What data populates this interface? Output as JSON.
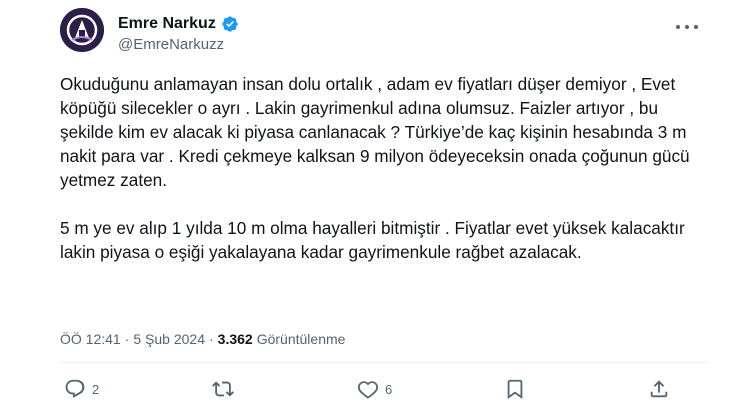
{
  "author": {
    "name": "Emre Narkuz",
    "handle": "@EmreNarkuzz"
  },
  "tweet": {
    "paragraph_1": "Okuduğunu anlamayan insan dolu ortalık , adam ev fiyatları düşer demiyor , Evet köpüğü silecekler o ayrı . Lakin gayrimenkul adına olumsuz. Faizler artıyor , bu şekilde kim ev alacak ki piyasa canlanacak ? Türkiye’de kaç kişinin hesabında 3 m nakit para var . Kredi çekmeye kalksan 9 milyon ödeyeceksin onada çoğunun gücü yetmez zaten.",
    "paragraph_2": "5 m ye ev alıp 1 yılda 10 m olma hayalleri bitmiştir . Fiyatlar evet yüksek kalacaktır lakin piyasa o eşiği yakalayana kadar gayrimenkule rağbet azalacak."
  },
  "meta": {
    "time": "ÖÖ 12:41",
    "sep1": "·",
    "date": "5 Şub 2024",
    "sep2": "·",
    "views_count": "3.362",
    "views_label": "Görüntülenme"
  },
  "actions": {
    "reply_count": "2",
    "like_count": "6"
  },
  "icons": {
    "verified": "verified-badge-icon",
    "more": "more-dots-icon",
    "reply": "reply-icon",
    "retweet": "retweet-icon",
    "like": "heart-icon",
    "bookmark": "bookmark-icon",
    "share": "share-icon"
  },
  "colors": {
    "text": "#0f1419",
    "secondary": "#536471",
    "verified": "#1d9bf0",
    "avatar_bg": "#2b1f4a"
  }
}
